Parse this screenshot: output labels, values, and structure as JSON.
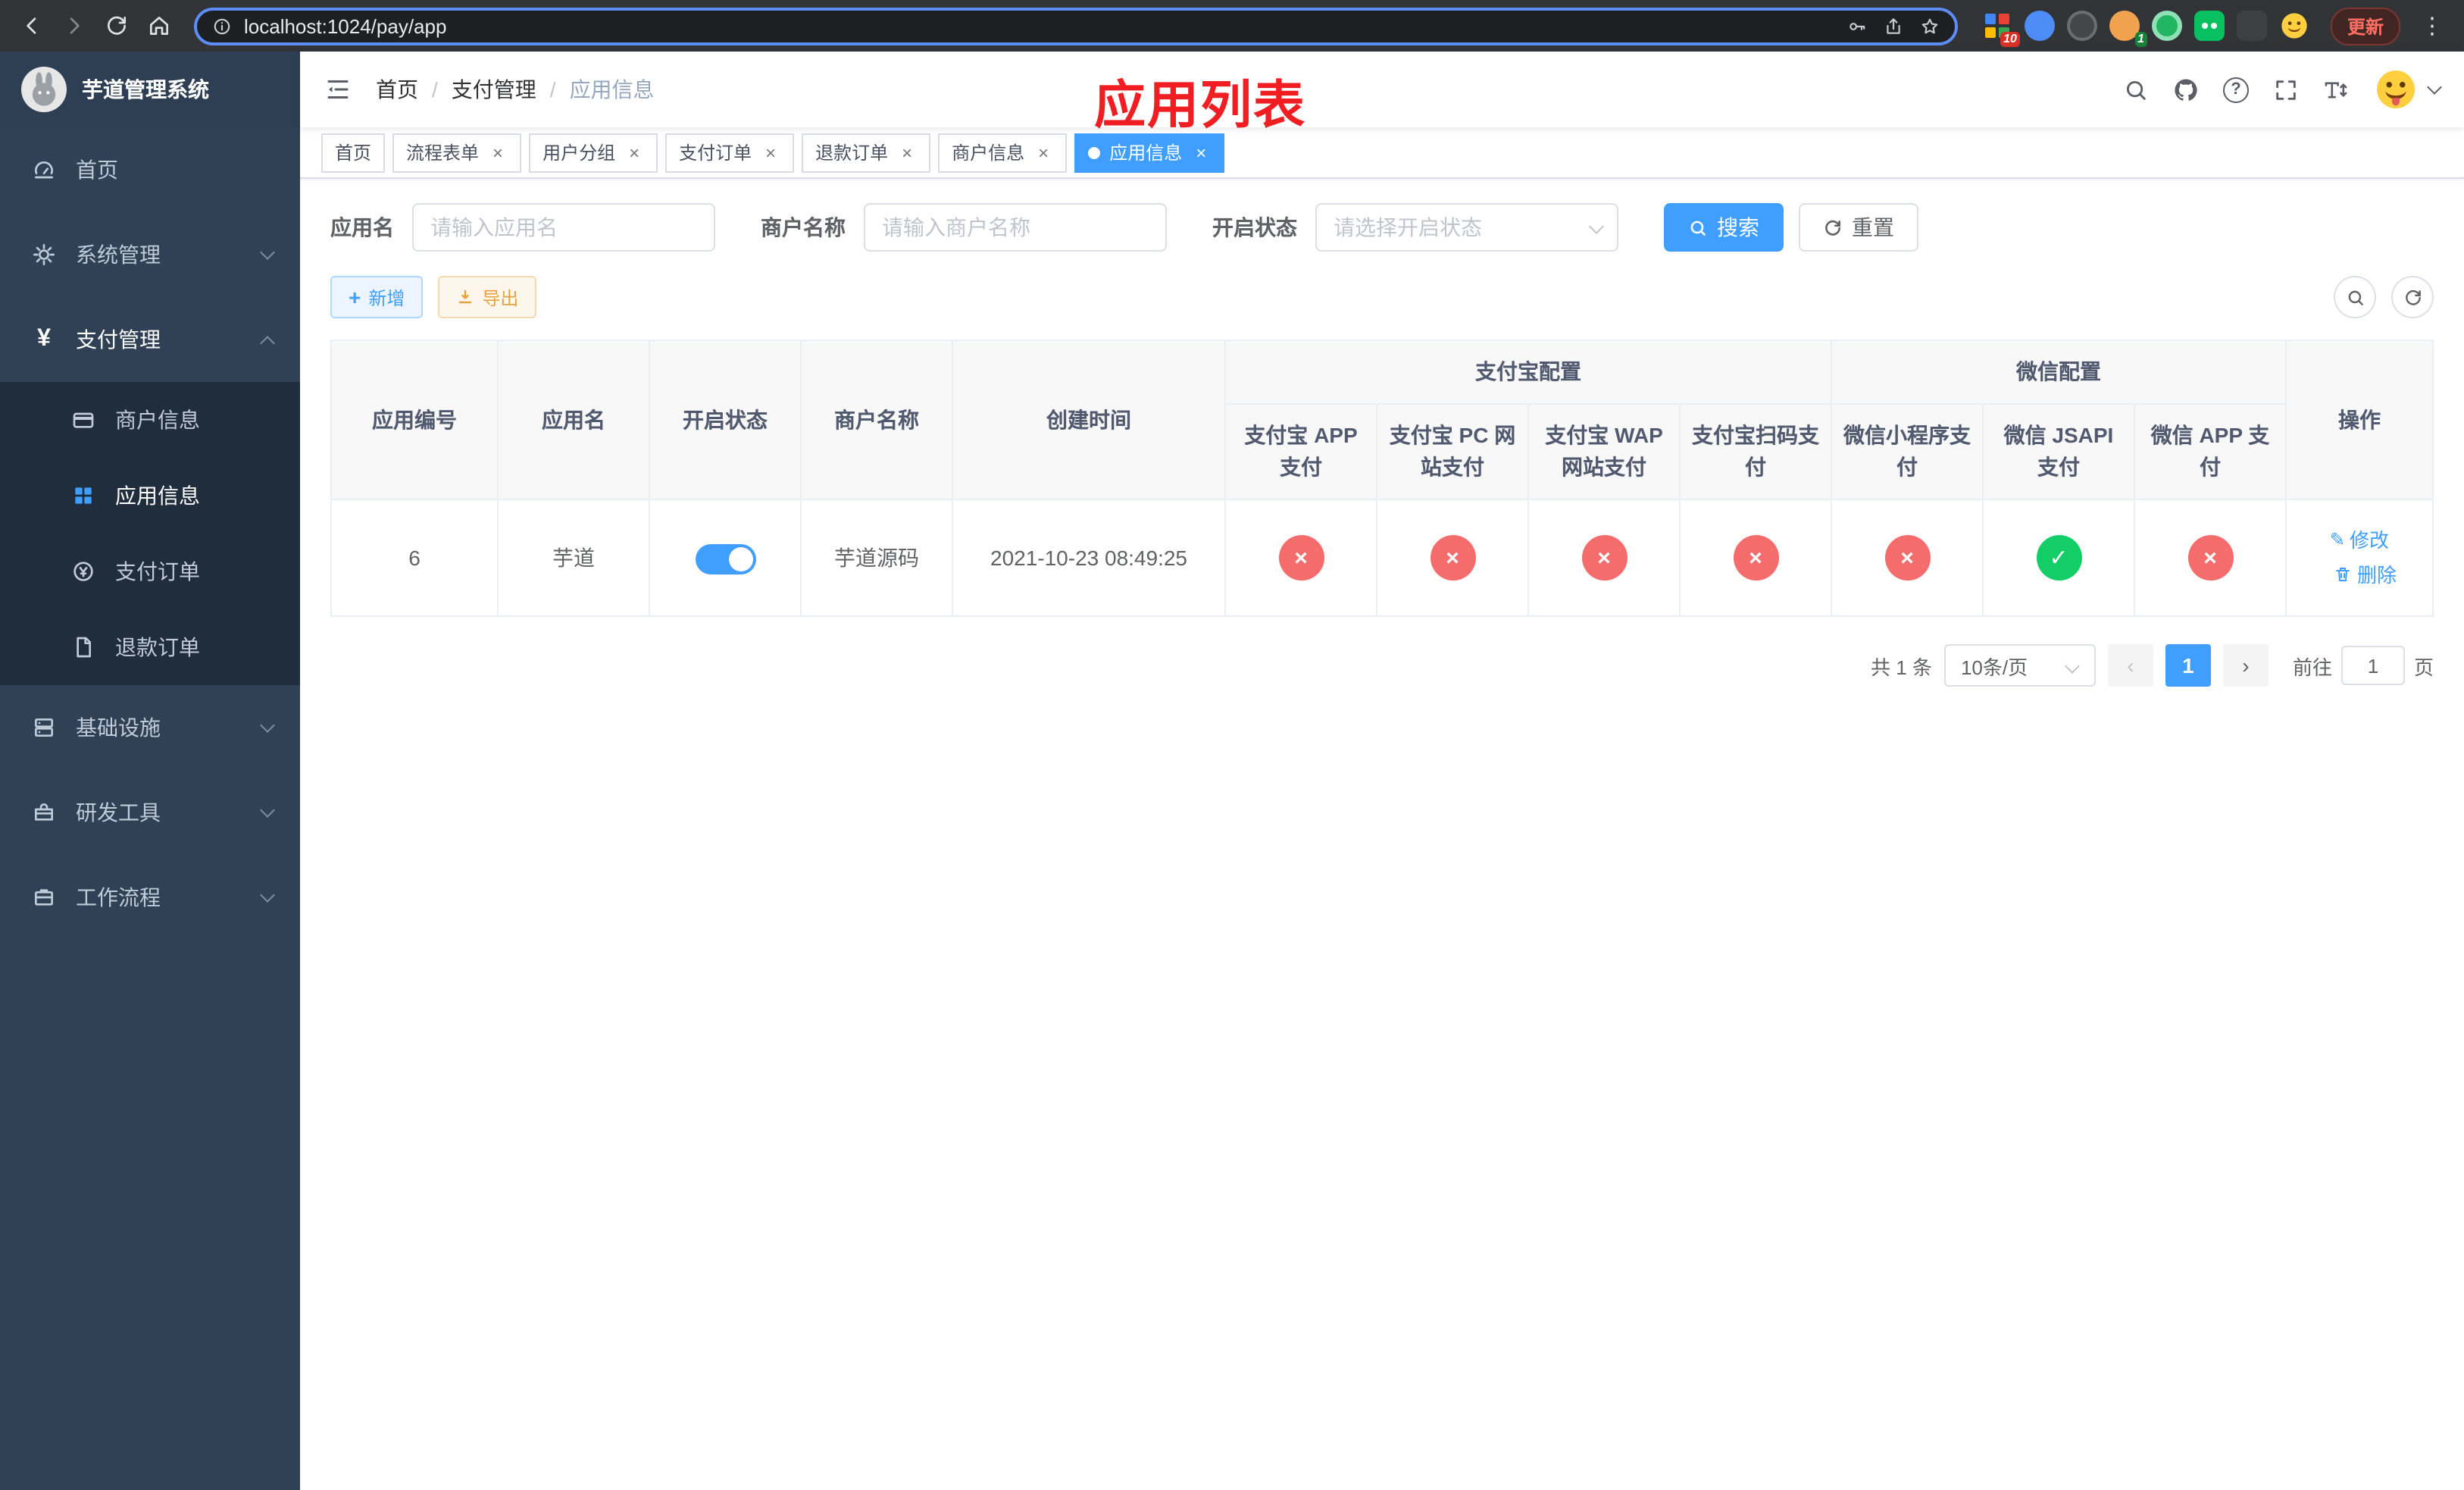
{
  "colors": {
    "accent": "#409eff",
    "danger": "#f56c6c",
    "success": "#13ce66",
    "warning": "#e6a23c",
    "sidebar_bg": "#304156",
    "submenu_bg": "#1f2d3d",
    "annotation_red": "#f01d22"
  },
  "icons": {
    "close": "×",
    "check": "✓",
    "cross": "×",
    "question": "?",
    "more_vertical": "⋮",
    "yen": "¥",
    "prev": "‹",
    "next": "›",
    "pencil": "✎",
    "plus": "+"
  },
  "browser": {
    "url": "localhost:1024/pay/app",
    "update_label": "更新",
    "ext_badge_1": "10",
    "ext_badge_2": "1"
  },
  "sidebar": {
    "title": "芋道管理系统",
    "items": [
      {
        "label": "首页"
      },
      {
        "label": "系统管理"
      },
      {
        "label": "支付管理"
      },
      {
        "label": "基础设施"
      },
      {
        "label": "研发工具"
      },
      {
        "label": "工作流程"
      }
    ],
    "submenu": [
      {
        "label": "商户信息"
      },
      {
        "label": "应用信息"
      },
      {
        "label": "支付订单"
      },
      {
        "label": "退款订单"
      }
    ]
  },
  "header": {
    "breadcrumb": [
      "首页",
      "支付管理",
      "应用信息"
    ],
    "annotation": "应用列表"
  },
  "tabs": [
    {
      "label": "首页"
    },
    {
      "label": "流程表单"
    },
    {
      "label": "用户分组"
    },
    {
      "label": "支付订单"
    },
    {
      "label": "退款订单"
    },
    {
      "label": "商户信息"
    },
    {
      "label": "应用信息"
    }
  ],
  "filters": {
    "app_name_label": "应用名",
    "app_name_placeholder": "请输入应用名",
    "merchant_label": "商户名称",
    "merchant_placeholder": "请输入商户名称",
    "status_label": "开启状态",
    "status_placeholder": "请选择开启状态",
    "search_label": "搜索",
    "reset_label": "重置"
  },
  "toolbar": {
    "add_label": "新增",
    "export_label": "导出"
  },
  "table": {
    "groups": {
      "alipay": "支付宝配置",
      "wechat": "微信配置"
    },
    "columns": [
      "应用编号",
      "应用名",
      "开启状态",
      "商户名称",
      "创建时间",
      "操作"
    ],
    "sub_columns": [
      "支付宝 APP 支付",
      "支付宝 PC 网站支付",
      "支付宝 WAP 网站支付",
      "支付宝扫码支付",
      "微信小程序支付",
      "微信 JSAPI 支付",
      "微信 APP 支付"
    ],
    "row": {
      "id": "6",
      "name": "芋道",
      "enabled": true,
      "merchant": "芋道源码",
      "created_at": "2021-10-23 08:49:25",
      "statuses": [
        "no",
        "no",
        "no",
        "no",
        "no",
        "yes",
        "no"
      ],
      "edit_label": "修改",
      "delete_label": "删除"
    }
  },
  "pagination": {
    "total": "共 1 条",
    "page_size": "10条/页",
    "current_page": "1",
    "goto_label": "前往",
    "goto_value": "1",
    "page_unit": "页"
  }
}
